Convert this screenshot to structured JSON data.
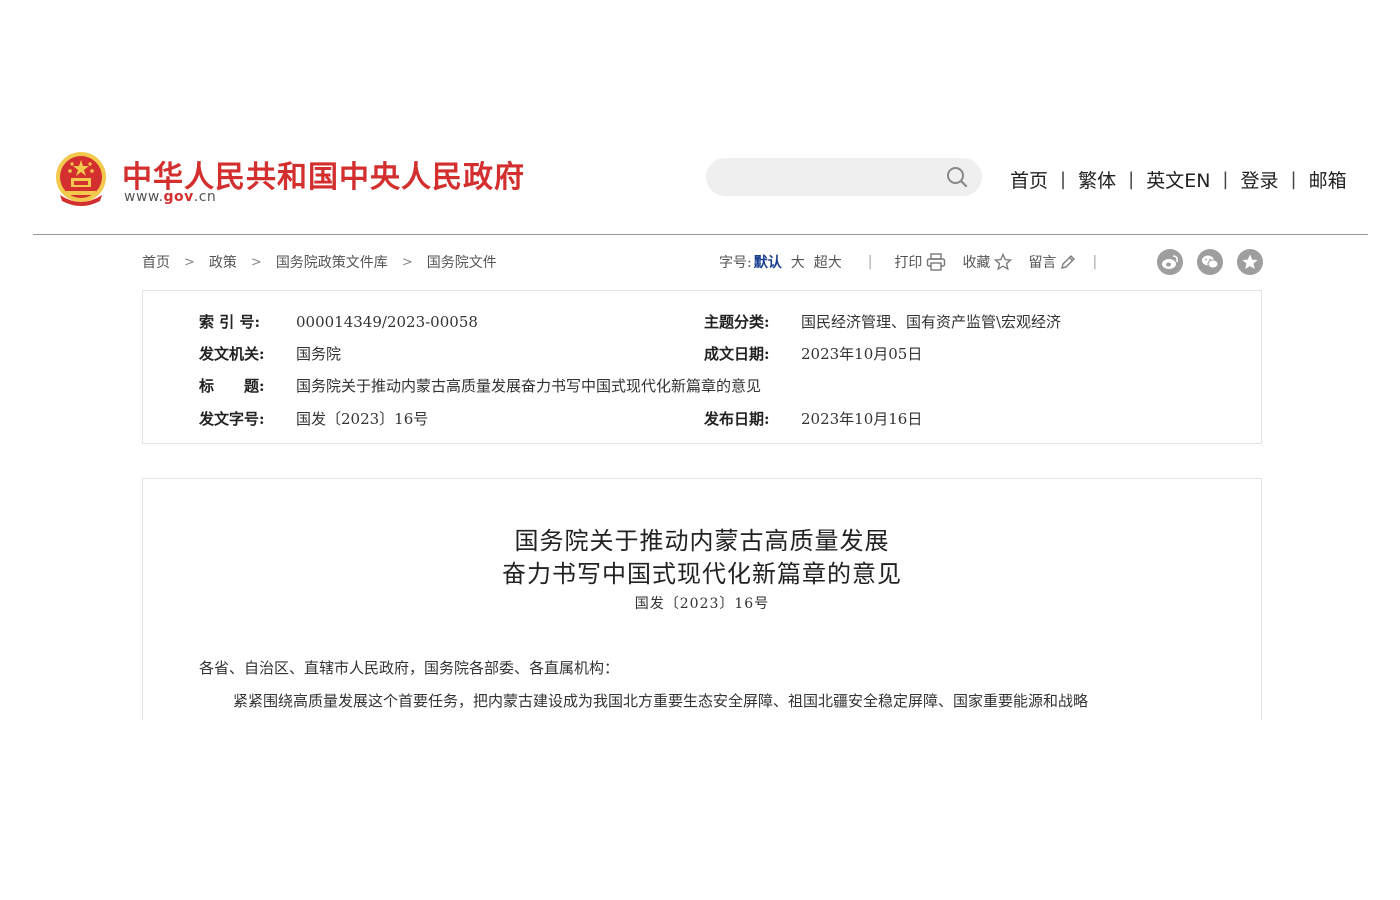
{
  "header": {
    "site_name": "中华人民共和国中央人民政府",
    "site_url_prefix": "www.",
    "site_url_domain": "gov",
    "site_url_suffix": ".cn",
    "search_placeholder": "",
    "nav": [
      "首页",
      "繁体",
      "英文EN",
      "登录",
      "邮箱"
    ],
    "nav_separator": "|"
  },
  "breadcrumb": [
    "首页",
    "政策",
    "国务院政策文件库",
    "国务院文件"
  ],
  "breadcrumb_separator": ">",
  "toolbar": {
    "font_size_label": "字号:",
    "font_default": "默认",
    "font_large": "大",
    "font_xlarge": "超大",
    "separator": "|",
    "print": "打印",
    "favorite": "收藏",
    "comment": "留言"
  },
  "share_icons": [
    "weibo-icon",
    "wechat-icon",
    "qzone-icon"
  ],
  "metadata": {
    "index_label": "索 引 号:",
    "index_value": "000014349/2023-00058",
    "topic_label": "主题分类:",
    "topic_value": "国民经济管理、国有资产监管\\宏观经济",
    "issuer_label": "发文机关:",
    "issuer_value": "国务院",
    "written_label": "成文日期:",
    "written_value": "2023年10月05日",
    "title_label": "标　　题:",
    "title_value": "国务院关于推动内蒙古高质量发展奋力书写中国式现代化新篇章的意见",
    "docno_label": "发文字号:",
    "docno_value": "国发〔2023〕16号",
    "published_label": "发布日期:",
    "published_value": "2023年10月16日"
  },
  "article": {
    "title_line1": "国务院关于推动内蒙古高质量发展",
    "title_line2": "奋力书写中国式现代化新篇章的意见",
    "doc_number": "国发〔2023〕16号",
    "salutation": "各省、自治区、直辖市人民政府，国务院各部委、各直属机构：",
    "paragraph1": "紧紧围绕高质量发展这个首要任务，把内蒙古建设成为我国北方重要生态安全屏障、祖国北疆安全稳定屏障、国家重要能源和战略"
  },
  "colors": {
    "brand_red": "#d32f2f",
    "active_blue": "#1a3f8f",
    "share_gray": "#9e9e9e"
  }
}
